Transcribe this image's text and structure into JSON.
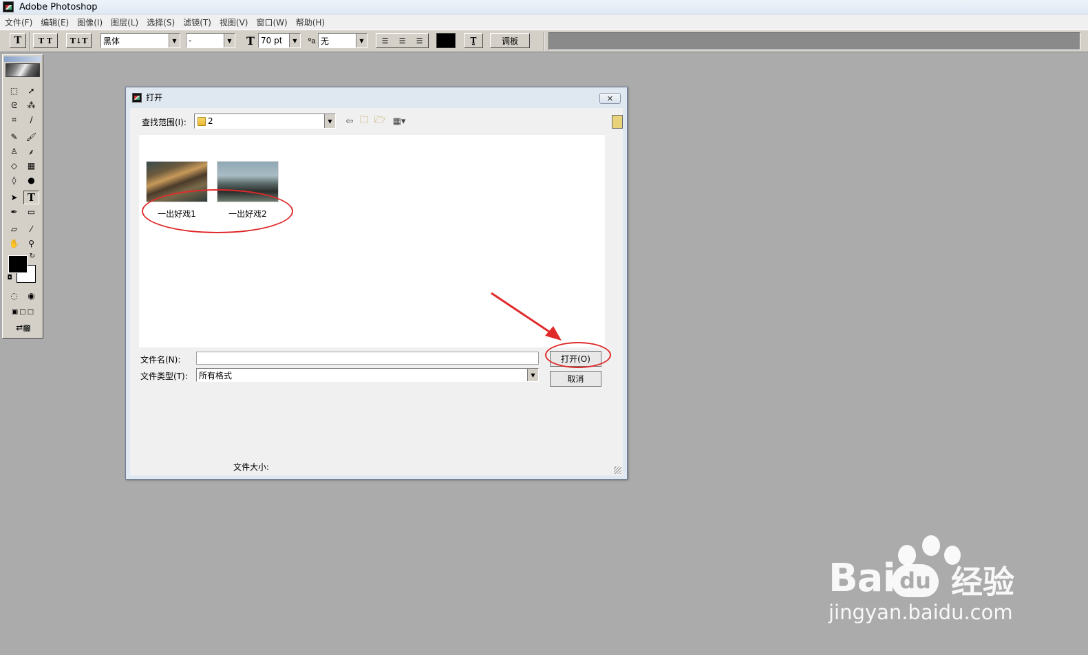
{
  "app": {
    "title": "Adobe Photoshop"
  },
  "menu": [
    "文件(F)",
    "编辑(E)",
    "图像(I)",
    "图层(L)",
    "选择(S)",
    "滤镜(T)",
    "视图(V)",
    "窗口(W)",
    "帮助(H)"
  ],
  "options_bar": {
    "font_family": "黑体",
    "font_style": "-",
    "font_size": "70 pt",
    "antialias": "无",
    "palette_label": "调板",
    "text_color": "#000000"
  },
  "dialog": {
    "title": "打开",
    "close_symbol": "✕",
    "look_in_label": "查找范围(I):",
    "look_in_value": "2",
    "files": [
      {
        "name": "一出好戏1"
      },
      {
        "name": "一出好戏2"
      }
    ],
    "filename_label": "文件名(N):",
    "filename_value": "",
    "filetype_label": "文件类型(T):",
    "filetype_value": "所有格式",
    "open_button": "打开(O)",
    "cancel_button": "取消",
    "file_size_label": "文件大小:"
  },
  "watermark": {
    "brand": "Bai",
    "brand_cn": "经验",
    "url": "jingyan.baidu.com"
  },
  "colors": {
    "annotation_red": "#e02a2a",
    "workspace": "#ababab"
  }
}
